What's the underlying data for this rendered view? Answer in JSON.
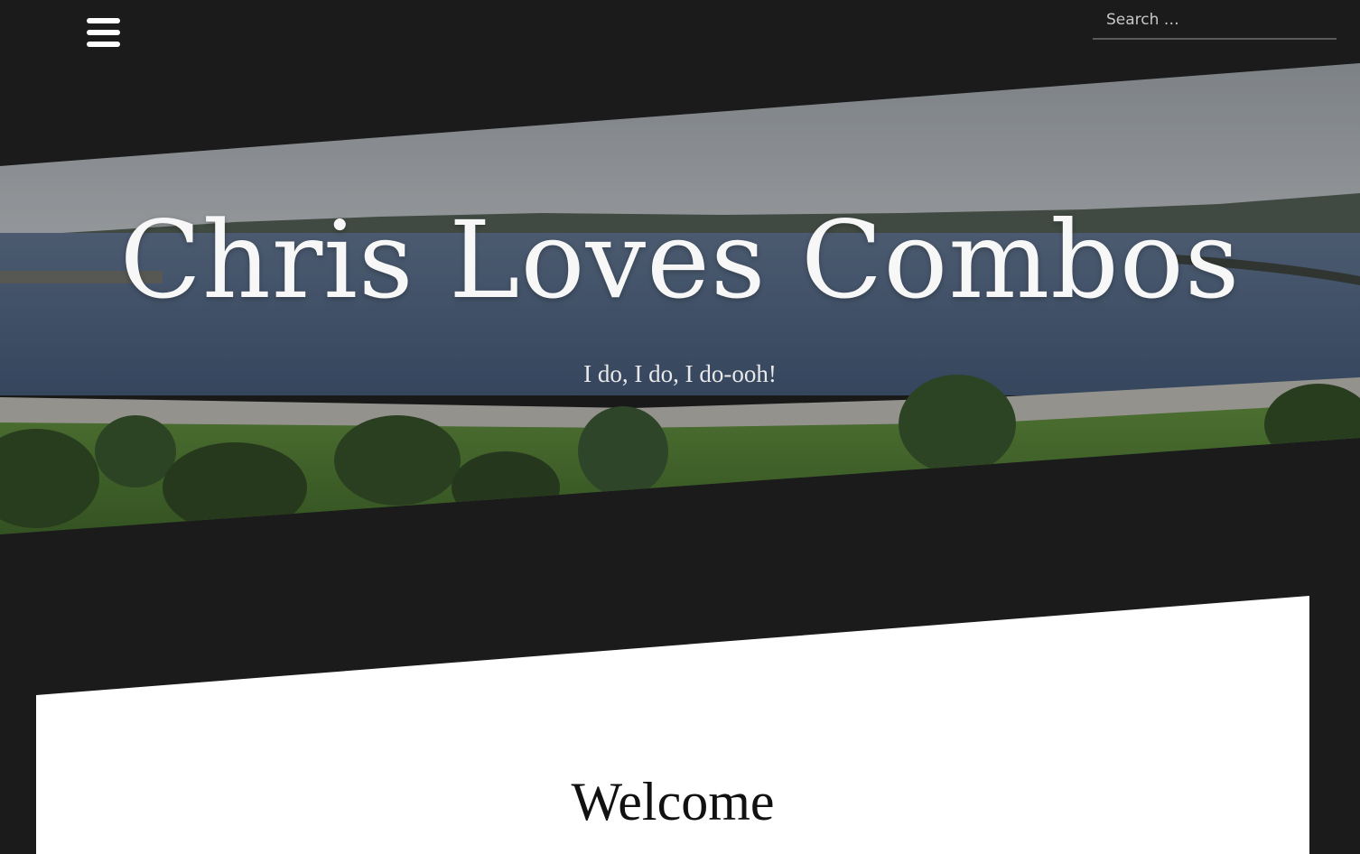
{
  "header": {
    "menu_icon": "hamburger-menu-icon",
    "search": {
      "placeholder": "Search …",
      "value": ""
    }
  },
  "hero": {
    "title": "Chris Loves Combos",
    "tagline": "I do, I do, I do-ooh!"
  },
  "content": {
    "heading": "Welcome"
  },
  "colors": {
    "background": "#1b1b1b",
    "card": "#ffffff",
    "title_text": "#f7f7f7"
  }
}
